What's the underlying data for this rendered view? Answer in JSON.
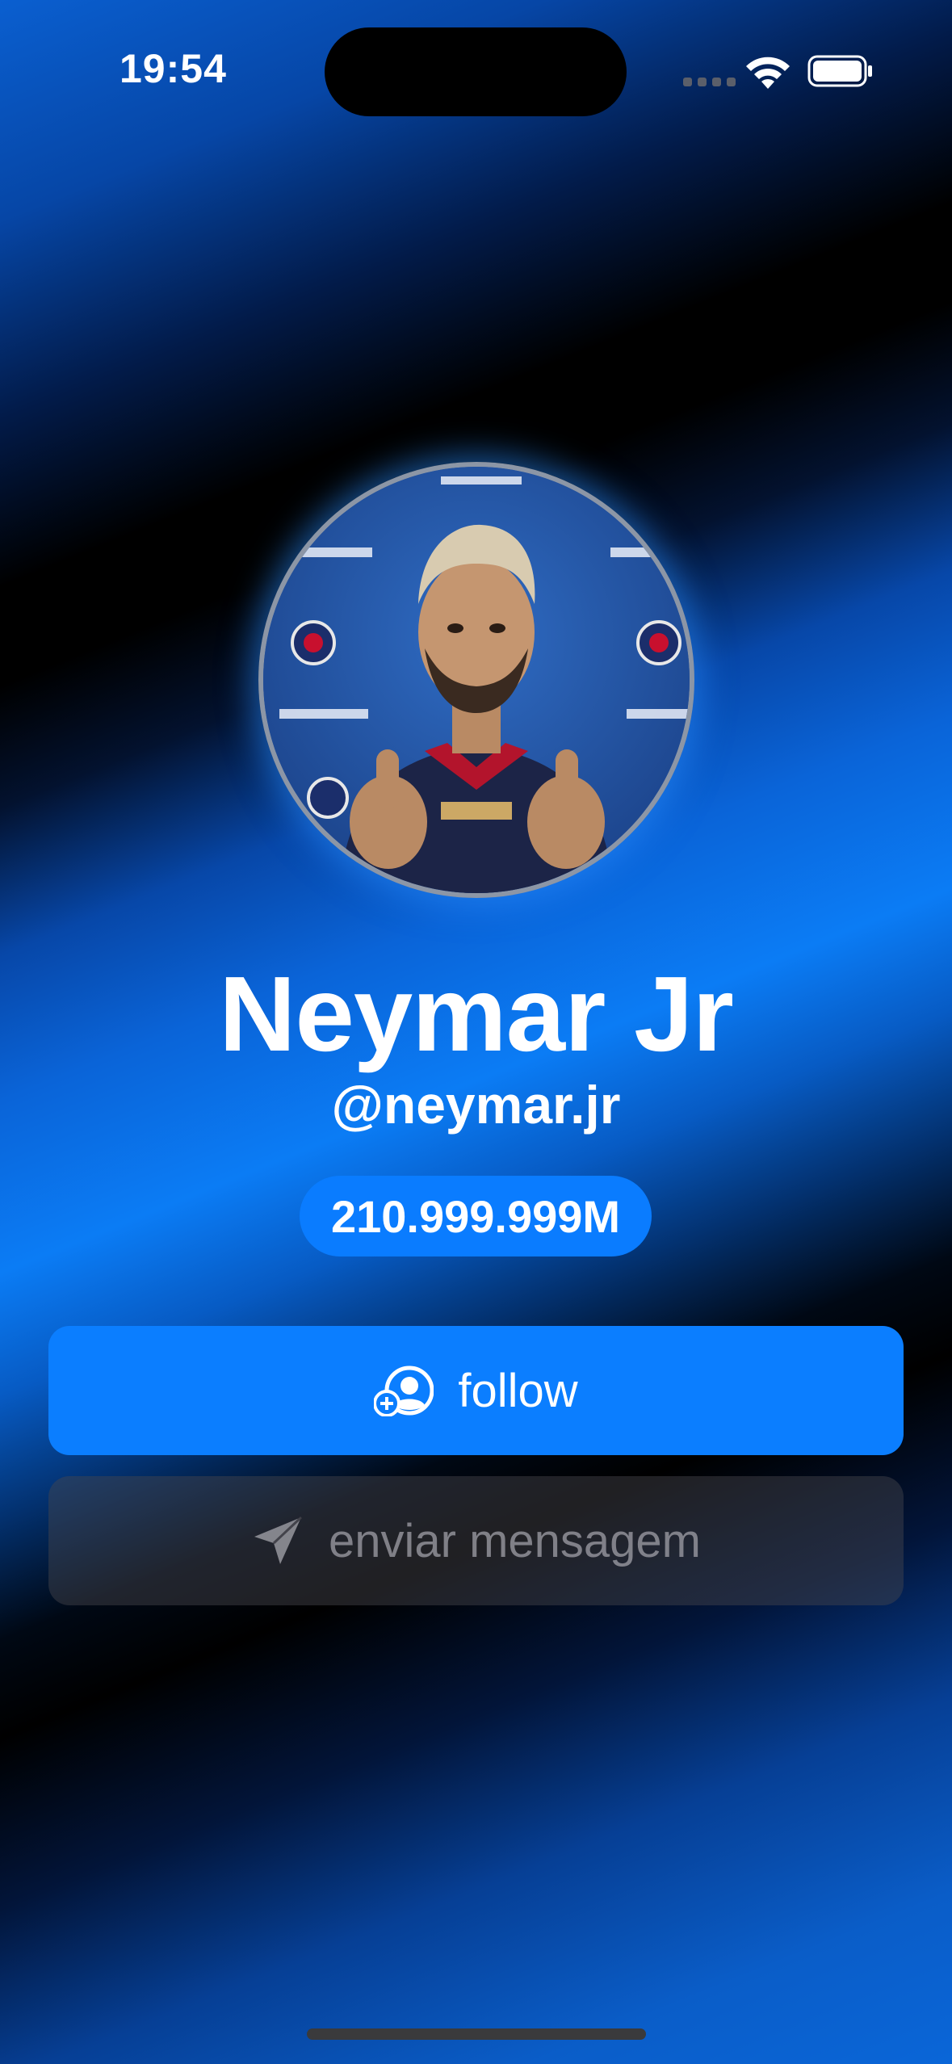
{
  "status_bar": {
    "time": "19:54"
  },
  "profile": {
    "name": "Neymar Jr",
    "handle": "@neymar.jr",
    "followers": "210.999.999M"
  },
  "actions": {
    "follow_label": "follow",
    "message_label": "enviar mensagem"
  },
  "colors": {
    "accent": "#0b7eff",
    "background_dark": "#000000",
    "background_blue": "#0a64d8"
  },
  "icons": {
    "follow": "person-add-icon",
    "message": "paper-plane-icon"
  }
}
